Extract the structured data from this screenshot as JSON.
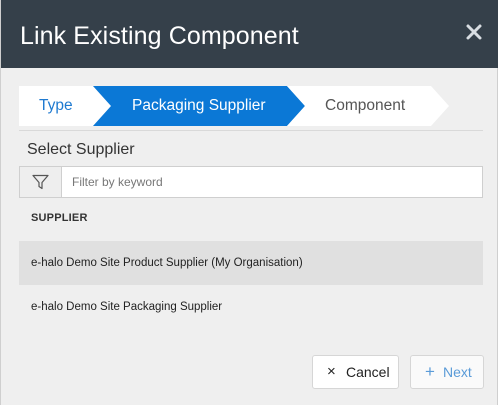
{
  "dialog": {
    "title": "Link Existing Component",
    "close_symbol": "×"
  },
  "wizard": {
    "steps": [
      {
        "label": "Type",
        "state": "completed"
      },
      {
        "label": "Packaging Supplier",
        "state": "active"
      },
      {
        "label": "Component",
        "state": "upcoming"
      }
    ],
    "colors": {
      "active": "#0b78d6",
      "inactive": "#ffffff",
      "completed_text": "#1f7ad0"
    }
  },
  "supplier_section": {
    "title": "Select Supplier",
    "filter": {
      "icon": "filter-icon",
      "placeholder": "Filter by keyword",
      "value": ""
    },
    "table": {
      "column_header": "SUPPLIER",
      "rows": [
        {
          "name": "e-halo Demo Site Product Supplier (My Organisation)",
          "highlighted": true
        },
        {
          "name": "e-halo Demo Site Packaging Supplier",
          "highlighted": false
        }
      ]
    }
  },
  "footer": {
    "cancel": {
      "icon": "×",
      "label": "Cancel"
    },
    "next": {
      "icon": "+",
      "label": "Next",
      "enabled": false
    }
  },
  "colors": {
    "titlebar": "#35404a",
    "body": "#efefef",
    "accent": "#0b78d6"
  }
}
